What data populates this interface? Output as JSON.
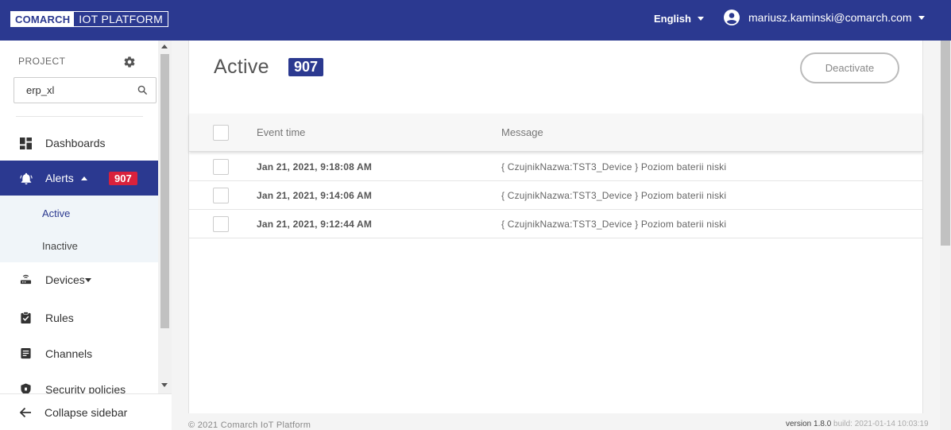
{
  "header": {
    "brand": "COMARCH",
    "product": "IOT PLATFORM",
    "language": "English",
    "user_email": "mariusz.kaminski@comarch.com"
  },
  "sidebar": {
    "project_label": "PROJECT",
    "project_value": "erp_xl",
    "items": [
      {
        "label": "Dashboards",
        "icon": "dashboard-icon"
      },
      {
        "label": "Alerts",
        "icon": "bell-icon",
        "badge": "907"
      },
      {
        "label": "Devices",
        "icon": "router-icon"
      },
      {
        "label": "Rules",
        "icon": "clipboard-check-icon"
      },
      {
        "label": "Channels",
        "icon": "document-icon"
      },
      {
        "label": "Security policies",
        "icon": "shield-icon"
      }
    ],
    "subitems": [
      {
        "label": "Active"
      },
      {
        "label": "Inactive"
      }
    ],
    "collapse_label": "Collapse sidebar"
  },
  "main": {
    "title": "Active",
    "count": "907",
    "deactivate_label": "Deactivate",
    "columns": [
      "Event time",
      "Message"
    ],
    "rows": [
      {
        "time": "Jan 21, 2021, 9:18:08 AM",
        "message": "{ CzujnikNazwa:TST3_Device } Poziom baterii niski"
      },
      {
        "time": "Jan 21, 2021, 9:14:06 AM",
        "message": "{ CzujnikNazwa:TST3_Device } Poziom baterii niski"
      },
      {
        "time": "Jan 21, 2021, 9:12:44 AM",
        "message": "{ CzujnikNazwa:TST3_Device } Poziom baterii niski"
      }
    ]
  },
  "footer": {
    "copyright": "© 2021 Comarch IoT Platform",
    "version": "version 1.8.0",
    "build": "build: 2021-01-14 10:03:19"
  },
  "colors": {
    "primary": "#2b3990",
    "badge_red": "#d9213c"
  }
}
